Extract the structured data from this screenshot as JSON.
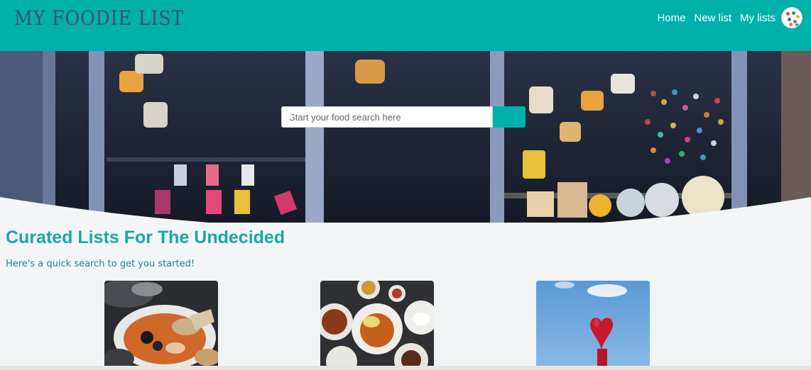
{
  "header": {
    "logo": "MY FOODIE LIST",
    "nav": [
      {
        "label": "Home"
      },
      {
        "label": "New list"
      },
      {
        "label": "My lists"
      }
    ],
    "brand_color": "#00b0aa"
  },
  "search": {
    "placeholder": "Start your food search here",
    "button_icon": "search-icon"
  },
  "section": {
    "title": "Curated Lists For The Undecided",
    "subtitle": "Here's a quick search to get you started!"
  },
  "cards": [
    {
      "image": "seafood-dish-photo"
    },
    {
      "image": "curry-dishes-photo"
    },
    {
      "image": "red-heart-sculpture-photo"
    }
  ]
}
